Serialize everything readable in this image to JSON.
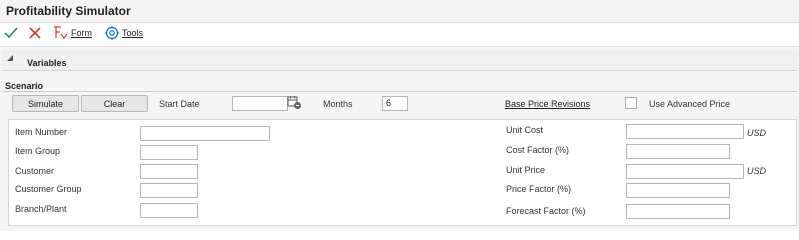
{
  "window": {
    "title": "Profitability Simulator"
  },
  "toolbar": {
    "form_label": "Form",
    "tools_label": "Tools"
  },
  "variables": {
    "label": "Variables"
  },
  "scenario": {
    "label": "Scenario",
    "simulate_label": "Simulate",
    "clear_label": "Clear",
    "start_date_label": "Start Date",
    "start_date_value": "",
    "months_label": "Months",
    "months_value": "6",
    "base_price_revisions_label": "Base Price Revisions",
    "use_advanced_price_label": "Use Advanced Price"
  },
  "fields": {
    "item_number": {
      "label": "Item Number",
      "value": ""
    },
    "item_group": {
      "label": "Item Group",
      "value": ""
    },
    "customer": {
      "label": "Customer",
      "value": ""
    },
    "customer_group": {
      "label": "Customer Group",
      "value": ""
    },
    "branch_plant": {
      "label": "Branch/Plant",
      "value": ""
    },
    "unit_cost": {
      "label": "Unit Cost",
      "value": "",
      "currency": "USD"
    },
    "cost_factor": {
      "label": "Cost Factor (%)",
      "value": ""
    },
    "unit_price": {
      "label": "Unit Price",
      "value": "",
      "currency": "USD"
    },
    "price_factor": {
      "label": "Price Factor (%)",
      "value": ""
    },
    "forecast_factor": {
      "label": "Forecast Factor (%)",
      "value": ""
    }
  },
  "colors": {
    "ok": "#2e8b57",
    "cancel": "#d93a2b",
    "accent": "#0a6cc2"
  }
}
